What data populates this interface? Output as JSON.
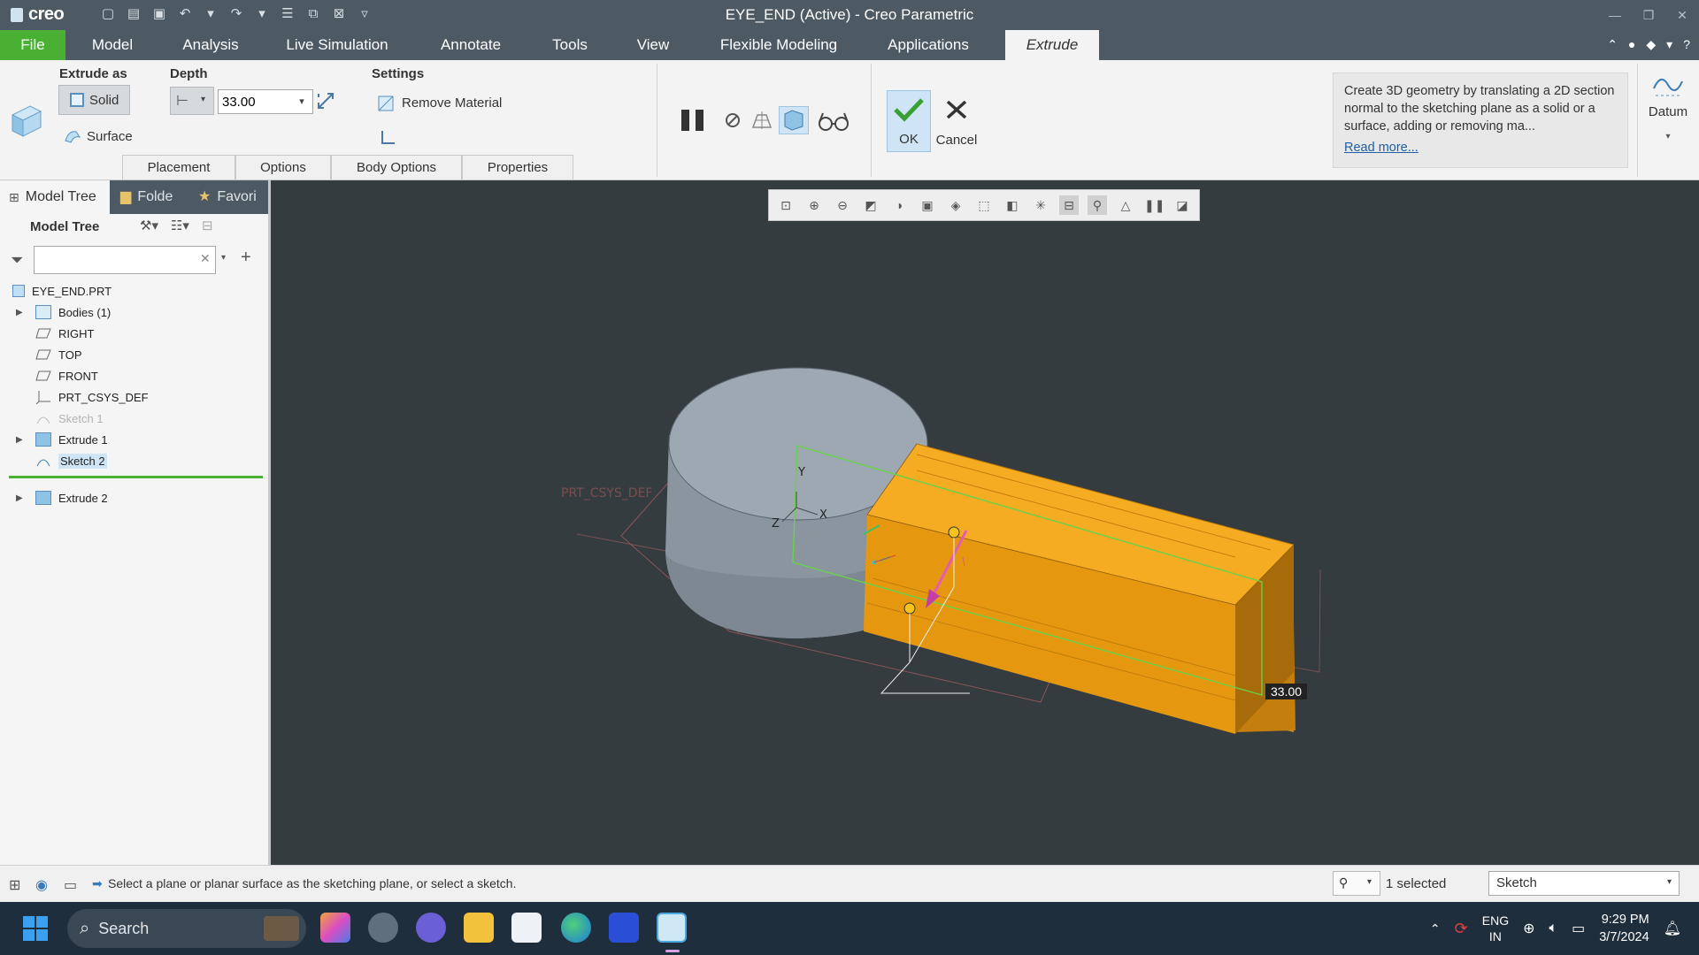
{
  "titlebar": {
    "logo": "creo",
    "title": "EYE_END (Active) - Creo Parametric"
  },
  "tabs": {
    "file": "File",
    "model": "Model",
    "analysis": "Analysis",
    "live_simulation": "Live Simulation",
    "annotate": "Annotate",
    "tools": "Tools",
    "view": "View",
    "flexible_modeling": "Flexible Modeling",
    "applications": "Applications",
    "extrude": "Extrude"
  },
  "ribbon": {
    "extrude_as": {
      "label": "Extrude as",
      "solid": "Solid",
      "surface": "Surface"
    },
    "depth": {
      "label": "Depth",
      "value": "33.00"
    },
    "settings": {
      "label": "Settings",
      "remove_material": "Remove Material"
    },
    "subtabs": {
      "placement": "Placement",
      "options": "Options",
      "body_options": "Body Options",
      "properties": "Properties"
    },
    "ok": "OK",
    "cancel": "Cancel",
    "tooltip": {
      "text": "Create 3D geometry by translating a 2D section normal to the sketching plane as a solid or a surface, adding or removing ma...",
      "link": "Read more..."
    },
    "datum": "Datum"
  },
  "left_panel": {
    "tabs": {
      "model_tree": "Model Tree",
      "folder": "Folde",
      "favorites": "Favori"
    },
    "header": "Model Tree",
    "tree": {
      "root": "EYE_END.PRT",
      "bodies": "Bodies (1)",
      "right": "RIGHT",
      "top": "TOP",
      "front": "FRONT",
      "csys": "PRT_CSYS_DEF",
      "sketch1": "Sketch 1",
      "extrude1": "Extrude 1",
      "sketch2": "Sketch 2",
      "extrude2": "Extrude 2"
    }
  },
  "viewport": {
    "csys_label": "PRT_CSYS_DEF",
    "axis_y": "Y",
    "axis_z": "Z",
    "axis_x": "X",
    "dimension": "33.00"
  },
  "statusbar": {
    "message": "Select a plane or planar surface as the sketching plane, or select a sketch.",
    "selected": "1 selected",
    "filter": "Sketch"
  },
  "taskbar": {
    "search": "Search",
    "lang_top": "ENG",
    "lang_bottom": "IN",
    "time": "9:29 PM",
    "date": "3/7/2024"
  },
  "colors": {
    "accent_green": "#4ab033",
    "titlebar": "#4d5a63",
    "viewport_bg": "#353c40",
    "extrude_orange": "#f0a21b",
    "cylinder_grey": "#9aa4ae"
  }
}
